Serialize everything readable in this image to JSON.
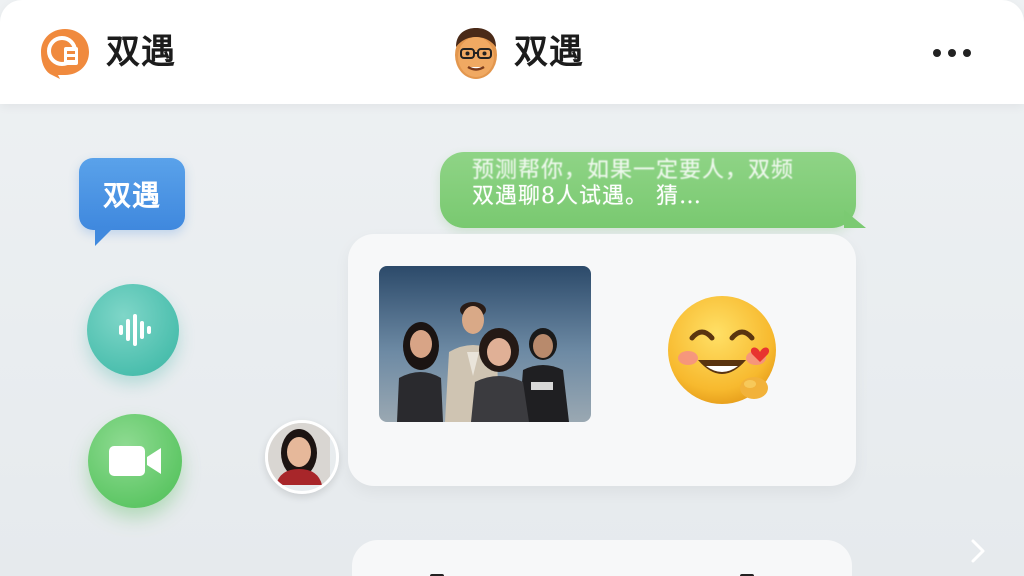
{
  "header": {
    "app_name": "双遇",
    "contact_name": "双遇",
    "more_label": "•••"
  },
  "left_actions": {
    "brand_bubble_label": "双遇",
    "voice_icon": "voice-wave-icon",
    "video_icon": "video-camera-icon"
  },
  "messages": {
    "sent": {
      "line1": "预测帮你，如果一定要人，双频",
      "line2": "双遇聊8人试遇。 猜…"
    },
    "received": {
      "photo_alt": "group-photo",
      "emoji": "smiling-face-with-hearts-emoji"
    }
  },
  "colors": {
    "brand_orange": "#f08a3e",
    "brand_blue": "#4a93e4",
    "voice_teal": "#4cbfae",
    "video_green": "#5fc766",
    "sent_bubble_green": "#84cf7b"
  }
}
